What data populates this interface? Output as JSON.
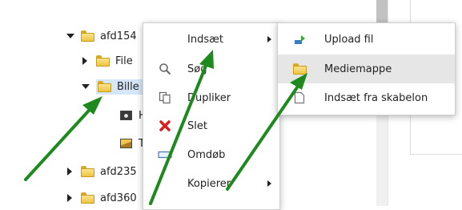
{
  "tree": {
    "nodes": [
      {
        "label": "afd154",
        "expander": "expanded"
      },
      {
        "label": "File",
        "expander": "collapsed"
      },
      {
        "label": "Bille",
        "expander": "expanded",
        "selected": true
      },
      {
        "label": "H"
      },
      {
        "label": "T"
      },
      {
        "label": "afd235",
        "expander": "collapsed"
      },
      {
        "label": "afd360",
        "expander": "collapsed"
      }
    ]
  },
  "context_menu": {
    "items": [
      {
        "label": "Indsæt",
        "icon": "none",
        "has_submenu": true
      },
      {
        "label": "Søg",
        "icon": "search-icon"
      },
      {
        "label": "Dupliker",
        "icon": "duplicate-icon"
      },
      {
        "label": "Slet",
        "icon": "delete-x-icon"
      },
      {
        "label": "Omdøb",
        "icon": "rename-icon"
      },
      {
        "label": "Kopierer",
        "icon": "none",
        "has_submenu": true
      }
    ]
  },
  "submenu": {
    "items": [
      {
        "label": "Upload fil",
        "icon": "upload-icon"
      },
      {
        "label": "Mediemappe",
        "icon": "folder-icon",
        "highlighted": true
      },
      {
        "label": "Indsæt fra skabelon",
        "icon": "template-icon"
      }
    ]
  },
  "colors": {
    "arrow": "#1e8a1e",
    "selection": "#d4e6f7",
    "highlight": "#e6e6e6",
    "delete": "#d62020",
    "upload": "#3b7dc4"
  }
}
